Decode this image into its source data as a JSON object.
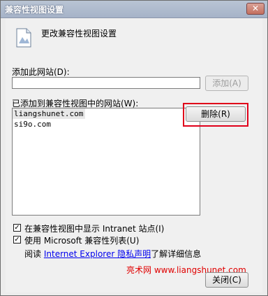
{
  "window": {
    "title": "兼容性视图设置",
    "close_glyph": "✕"
  },
  "header": {
    "icon": "page-settings-icon",
    "title": "更改兼容性视图设置"
  },
  "add_site": {
    "label": "添加此网站(D):",
    "value": "",
    "button_label": "添加(A)"
  },
  "site_list": {
    "label": "已添加到兼容性视图中的网站(W):",
    "items": [
      "liangshunet.com",
      "si9o.com"
    ],
    "remove_button_label": "删除(R)"
  },
  "options": {
    "intranet": {
      "label": "在兼容性视图中显示 Intranet 站点(I)",
      "checked": true
    },
    "ms_list": {
      "label": "使用 Microsoft 兼容性列表(U)",
      "checked": true
    }
  },
  "privacy": {
    "prefix": "阅读",
    "link": "Internet Explorer 隐私声明",
    "suffix": "了解详细信息"
  },
  "watermark": "亮术网 www.liangshunet.com",
  "footer": {
    "close_label": "关闭(C)"
  },
  "colors": {
    "highlight": "#e0001a",
    "link": "#0000ee"
  }
}
